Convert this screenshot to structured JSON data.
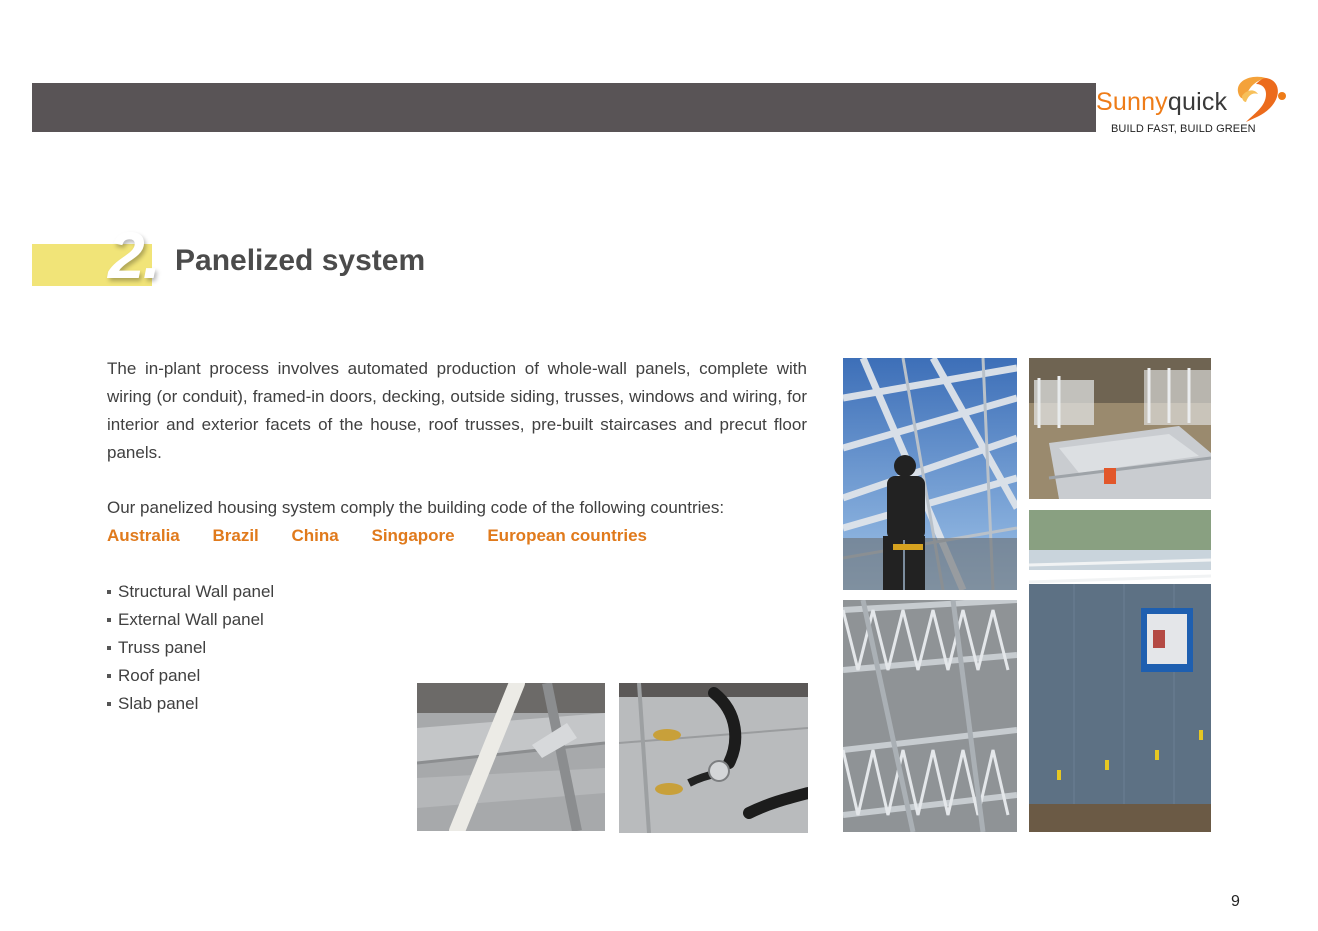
{
  "brand": {
    "name_part1": "Sunny",
    "name_part2": "quick",
    "tagline": "BUILD FAST, BUILD GREEN",
    "colors": {
      "orange": "#ee7c18",
      "header_gray": "#595456",
      "accent_yellow": "#f1e478",
      "country_orange": "#e07a1c"
    }
  },
  "section": {
    "number": "2.",
    "title": "Panelized system"
  },
  "intro_text": "The in-plant process involves automated production of whole-wall panels, complete with wiring (or conduit), framed-in doors, decking, outside siding, trusses, windows and wiring, for interior and exterior facets of the house, roof trusses, pre-built staircases and precut floor panels.",
  "comply_text": "Our panelized housing system comply the building code of the following countries:",
  "countries": [
    "Australia",
    "Brazil",
    "China",
    "Singapore",
    "European countries"
  ],
  "panel_types": [
    "Structural Wall panel",
    "External Wall panel",
    "Truss panel",
    "Roof panel",
    "Slab panel"
  ],
  "photos": [
    {
      "name": "roof-truss-worker-photo"
    },
    {
      "name": "factory-panels-photo"
    },
    {
      "name": "floor-truss-photo"
    },
    {
      "name": "clad-wall-window-photo"
    },
    {
      "name": "conduit-framing-photo"
    },
    {
      "name": "service-holes-photo"
    }
  ],
  "page_number": "9"
}
